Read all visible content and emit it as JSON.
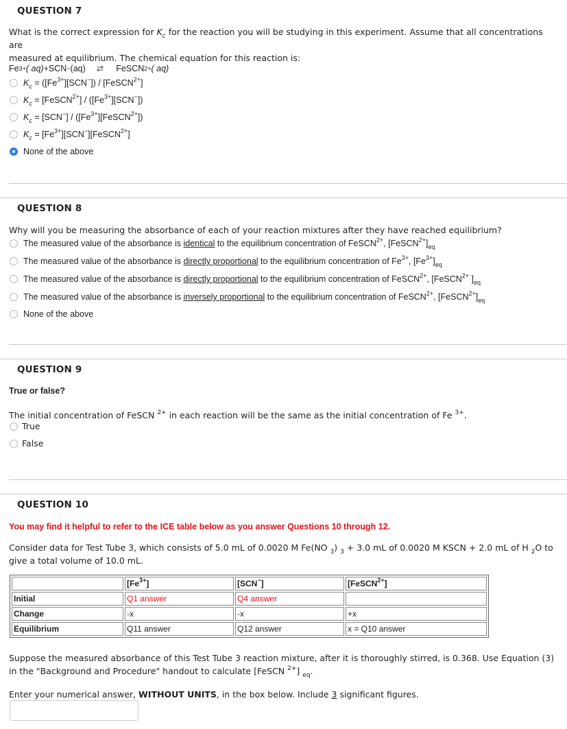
{
  "q7": {
    "title": "QUESTION 7",
    "prompt_line1_a": "What is the correct expression for ",
    "kc_k": "K",
    "kc_c": "c",
    "prompt_line1_b": " for the reaction you will be studying in this experiment.  Assume that all concentrations are",
    "prompt_line2": "measured at equilibrium.  The chemical equation for this reaction is:",
    "equation": {
      "fe": "Fe ",
      "fe_charge": "3+",
      "aq1": "( aq)",
      "plus": " + ",
      "scn": "SCN ",
      "scn_charge": "−",
      "aq2": "(aq)",
      "arrow": "⇄",
      "fescn": "FeSCN ",
      "fescn_charge": "2+",
      "aq3": "( aq)"
    },
    "options": [
      {
        "text": "= ([Fe3+][SCN−]) / [FeSCN2+]",
        "selected": false
      },
      {
        "text": "= [FeSCN2+] / ([Fe3+][SCN−])",
        "selected": false
      },
      {
        "text": "= [SCN−] / ([Fe3+][FeSCN2+])",
        "selected": false
      },
      {
        "text": "= [Fe3+][SCN−][FeSCN2+]",
        "selected": false
      },
      {
        "text": "None of the above",
        "selected": true
      }
    ]
  },
  "q8": {
    "title": "QUESTION 8",
    "prompt": "Why will you be measuring the absorbance of each of your reaction mixtures after they have reached equilibrium?",
    "stem": "The measured value of the absorbance is ",
    "mid": " to the equilibrium concentration of ",
    "options": [
      {
        "relation": "identical",
        "species": "FeSCN",
        "charge": "2+",
        "selected": false
      },
      {
        "relation": "directly proportional",
        "species": "Fe",
        "charge": "3+",
        "selected": false
      },
      {
        "relation": "directly proportional",
        "species": "FeSCN",
        "charge": "2+",
        "selected": false
      },
      {
        "relation": "inversely proportional",
        "species": "FeSCN",
        "charge": "2+",
        "selected": false
      },
      {
        "text": "None of the above",
        "selected": false
      }
    ],
    "eq_sub": "eq"
  },
  "q9": {
    "title": "QUESTION 9",
    "subtitle": "True or false?",
    "prompt_a": "The initial concentration of FeSCN ",
    "prompt_charge1": "2+",
    "prompt_b": " in each reaction will be the same as the initial concentration of Fe ",
    "prompt_charge2": "3+",
    "prompt_end": ".",
    "options": [
      {
        "text": "True",
        "selected": false
      },
      {
        "text": "False",
        "selected": false
      }
    ]
  },
  "q10": {
    "title": "QUESTION 10",
    "note": "You may find it helpful to refer to the ICE table below as you answer Questions 10 through 12.",
    "consider_a": "Consider data for Test Tube 3, which consists of 5.0 mL of 0.0020 M Fe(NO ",
    "consider_sub1": "3",
    "consider_b": ") ",
    "consider_sub2": "3",
    "consider_c": " + 3.0 mL of 0.0020 M KSCN + 2.0 mL of H ",
    "consider_sub3": "2",
    "consider_d": "O to",
    "consider_line2": "give a total volume of 10.0 mL.",
    "ice_table": {
      "headers": [
        "",
        "[Fe3+]",
        "[SCN−]",
        "[FeSCN2+]"
      ],
      "header_parts": [
        {
          "base": "[Fe",
          "sup": "3+",
          "end": "]"
        },
        {
          "base": "[SCN",
          "sup": "−",
          "end": "]"
        },
        {
          "base": "[FeSCN",
          "sup": "2+",
          "end": "]"
        }
      ],
      "rows": [
        {
          "label": "Initial",
          "cells": [
            "Q1 answer",
            "Q4 answer",
            ""
          ]
        },
        {
          "label": "Change",
          "cells": [
            "-x",
            "-x",
            "+x"
          ]
        },
        {
          "label": "Equilibrium",
          "cells": [
            "Q11 answer",
            "Q12 answer",
            "x = Q10 answer"
          ]
        }
      ]
    },
    "suppose_line1": "Suppose the measured absorbance of this Test Tube 3 reaction mixture, after it is thoroughly stirred, is 0.368.  Use Equation (3)",
    "suppose_line2_a": "in the \"Background and Procedure\" handout to calculate [FeSCN ",
    "suppose_charge": "2+",
    "suppose_line2_b": "] ",
    "suppose_sub": "eq",
    "suppose_end": ".",
    "enter_a": "Enter your numerical answer, ",
    "enter_bold": "WITHOUT UNITS",
    "enter_b": ", in the box below.  Include ",
    "enter_u": "3",
    "enter_c": " significant figures.",
    "answer_value": ""
  },
  "colors": {
    "radio_selected": "#2f7de1",
    "note_red": "#e8101a",
    "divider": "#c8c8c8"
  }
}
